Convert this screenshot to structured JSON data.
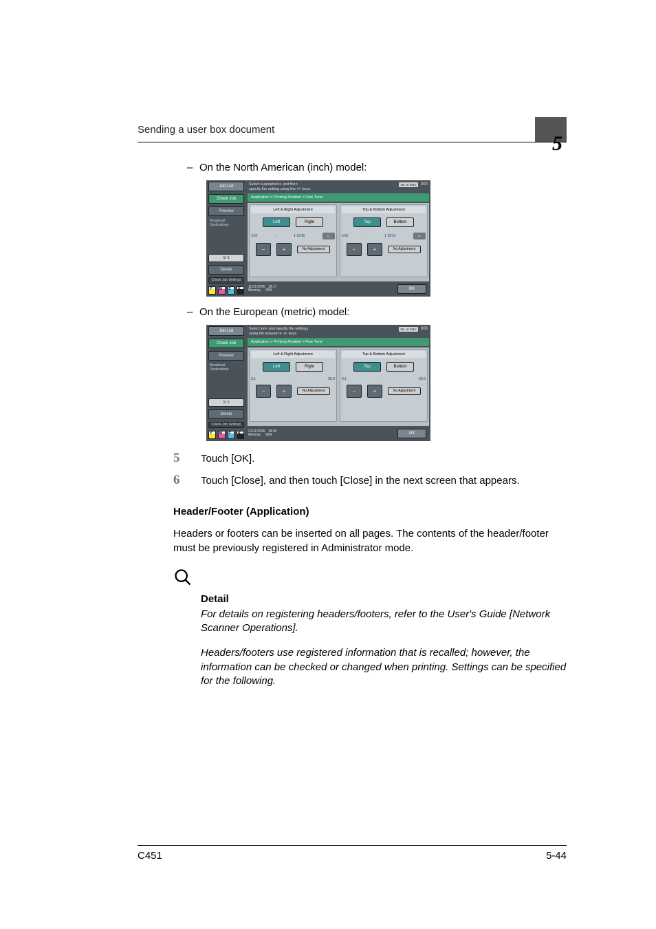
{
  "header": {
    "text": "Sending a user box document",
    "chapter": "5"
  },
  "body": {
    "bullet_na": "On the North American (inch) model:",
    "bullet_eu": "On the European (metric) model:",
    "steps": [
      {
        "num": "5",
        "text": "Touch [OK]."
      },
      {
        "num": "6",
        "text": "Touch [Close], and then touch [Close] in the next screen that appears."
      }
    ],
    "section_title": "Header/Footer (Application)",
    "section_para": "Headers or footers can be inserted on all pages. The contents of the header/footer must be previously registered in Administrator mode.",
    "detail_label": "Detail",
    "detail_p1": "For details on registering headers/footers, refer to the User's Guide [Network Scanner Operations].",
    "detail_p2": "Headers/footers use registered information that is recalled; however, the information can be checked or changed when printing. Settings can be specified for the following."
  },
  "device": {
    "sidebar": {
      "job_list": "Job List",
      "check_job": "Check Job",
      "preview": "Preview",
      "broadcast": "Broadcast\nDestinations",
      "page": "1/   1",
      "delete": "Delete",
      "check_job_settings": "Check Job\nSettings"
    },
    "breadcrumb": "Application > Printing Position > Fine-Tune",
    "panels": {
      "lr": {
        "header": "Left & Right Adjustment",
        "opt1": "Left",
        "opt2": "Right"
      },
      "tb": {
        "header": "Top & Bottom Adjustment",
        "opt1": "Top",
        "opt2": "Bottom"
      },
      "no_adjust": "No Adjustment"
    },
    "copies_label": "No. of\nSets:",
    "copies_count": "000",
    "memory_label": "Memory",
    "memory_pct": "99%",
    "ok": "OK",
    "inch": {
      "msg_l1": "Select a parameter, and then",
      "msg_l2": "specify the setting using the +/- keys.",
      "range_min": "1⁄16",
      "range_max": "1 15⁄16",
      "date": "11/21/2006",
      "time": "18:17"
    },
    "metric": {
      "msg_l1": "Select item and specify the settings",
      "msg_l2": "using the keypad or +/- keys.",
      "range_min": "0.1",
      "range_max": "50.0",
      "date": "21/11/2006",
      "time": "18:39"
    }
  },
  "footer": {
    "left": "C451",
    "right": "5-44"
  }
}
